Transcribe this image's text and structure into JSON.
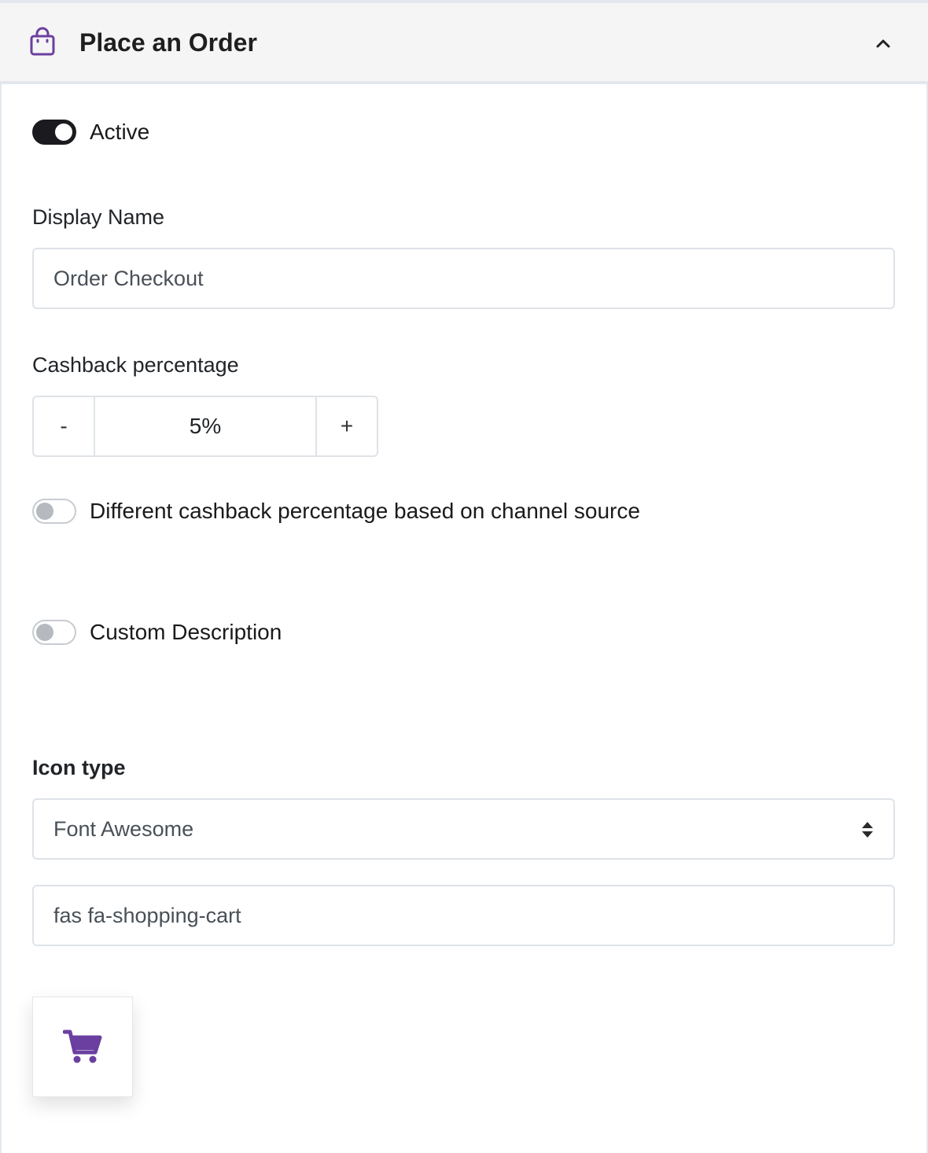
{
  "header": {
    "title": "Place an Order",
    "icon": "shopping-bag-icon",
    "collapse_icon": "chevron-up-icon"
  },
  "active_toggle": {
    "label": "Active",
    "state": "on"
  },
  "display_name": {
    "label": "Display Name",
    "value": "Order Checkout"
  },
  "cashback": {
    "label": "Cashback percentage",
    "decrement_label": "-",
    "value": "5%",
    "increment_label": "+"
  },
  "channel_toggle": {
    "label": "Different cashback percentage based on channel source",
    "state": "off"
  },
  "description_toggle": {
    "label": "Custom Description",
    "state": "off"
  },
  "icon_type": {
    "label": "Icon type",
    "selected": "Font Awesome",
    "icon_class_value": "fas fa-shopping-cart",
    "preview_icon": "shopping-cart-icon"
  },
  "colors": {
    "accent": "#6b3fa0",
    "toggle_on": "#1b1b1f",
    "header_bg": "#f5f5f5"
  }
}
